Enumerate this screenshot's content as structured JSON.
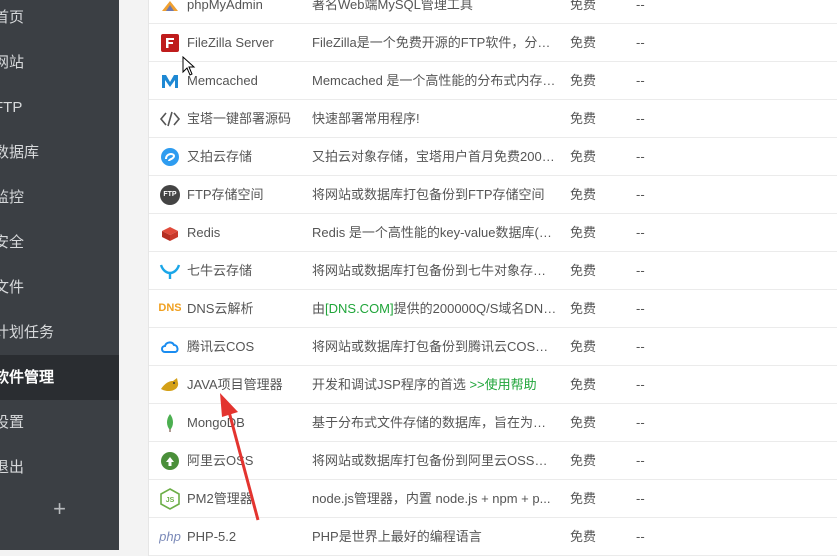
{
  "sidebar": {
    "items": [
      {
        "label": "首页"
      },
      {
        "label": "网站"
      },
      {
        "label": "FTP"
      },
      {
        "label": "数据库"
      },
      {
        "label": "监控"
      },
      {
        "label": "安全"
      },
      {
        "label": "文件"
      },
      {
        "label": "计划任务"
      },
      {
        "label": "软件管理"
      },
      {
        "label": "设置"
      },
      {
        "label": "退出"
      }
    ],
    "active": "软件管理",
    "add_label": "+"
  },
  "software": [
    {
      "name": "phpMyAdmin",
      "desc": "著名Web端MySQL管理工具",
      "price": "免费",
      "expire": "--",
      "icon": "phpmyadmin-icon"
    },
    {
      "name": "FileZilla Server",
      "desc": "FileZilla是一个免费开源的FTP软件，分为客...",
      "price": "免费",
      "expire": "--",
      "icon": "filezilla-icon"
    },
    {
      "name": "Memcached",
      "desc": "Memcached 是一个高性能的分布式内存对...",
      "price": "免费",
      "expire": "--",
      "icon": "memcached-icon"
    },
    {
      "name": "宝塔一键部署源码",
      "desc": "快速部署常用程序!",
      "price": "免费",
      "expire": "--",
      "icon": "code-icon"
    },
    {
      "name": "又拍云存储",
      "desc": "又拍云对象存储，宝塔用户首月免费200G...",
      "price": "免费",
      "expire": "--",
      "icon": "upyun-icon"
    },
    {
      "name": "FTP存储空间",
      "desc": "将网站或数据库打包备份到FTP存储空间",
      "price": "免费",
      "expire": "--",
      "icon": "ftp-storage-icon"
    },
    {
      "name": "Redis",
      "desc": "Redis 是一个高性能的key-value数据库(要...",
      "price": "免费",
      "expire": "--",
      "icon": "redis-icon"
    },
    {
      "name": "七牛云存储",
      "desc": "将网站或数据库打包备份到七牛对象存储空...",
      "price": "免费",
      "expire": "--",
      "icon": "qiniu-icon"
    },
    {
      "name": "DNS云解析",
      "desc_pre": "由",
      "desc_link": "[DNS.COM]",
      "desc_post": "提供的200000Q/S域名DNS...",
      "price": "免费",
      "expire": "--",
      "icon": "dns-icon"
    },
    {
      "name": "腾讯云COS",
      "desc": "将网站或数据库打包备份到腾讯云COS对象...",
      "price": "免费",
      "expire": "--",
      "icon": "tencent-cloud-icon"
    },
    {
      "name": "JAVA项目管理器",
      "desc_pre": "开发和调试JSP程序的首选 ",
      "desc_link": ">>使用帮助",
      "desc_post": "",
      "price": "免费",
      "expire": "--",
      "icon": "tomcat-icon"
    },
    {
      "name": "MongoDB",
      "desc": "基于分布式文件存储的数据库，旨在为WEB...",
      "price": "免费",
      "expire": "--",
      "icon": "mongodb-icon"
    },
    {
      "name": "阿里云OSS",
      "desc": "将网站或数据库打包备份到阿里云OSS对象...",
      "price": "免费",
      "expire": "--",
      "icon": "aliyun-oss-icon"
    },
    {
      "name": "PM2管理器",
      "desc": "node.js管理器，内置 node.js + npm + p...",
      "price": "免费",
      "expire": "--",
      "icon": "nodejs-icon"
    },
    {
      "name": "PHP-5.2",
      "desc": "PHP是世界上最好的编程语言",
      "price": "免费",
      "expire": "--",
      "icon": "php-icon"
    }
  ],
  "icon_labels": {
    "dns": "DNS",
    "php": "php",
    "js": "JS",
    "ftp": "FTP"
  }
}
